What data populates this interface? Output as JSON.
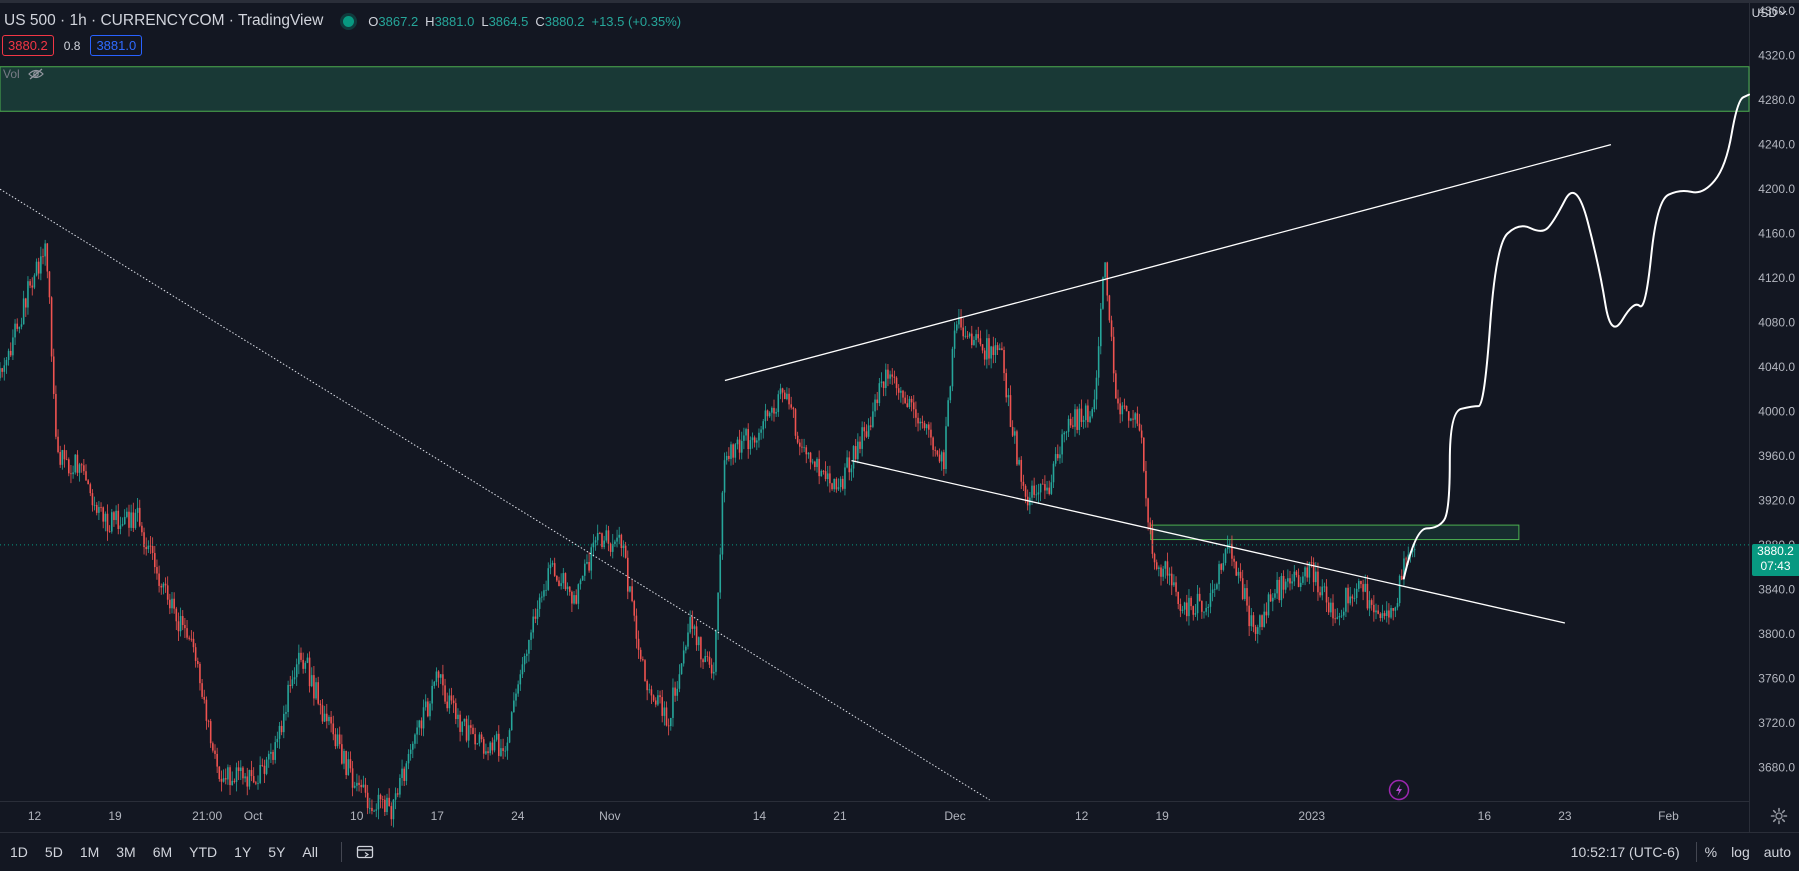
{
  "header": {
    "symbol_title": "US 500 · 1h · CURRENCYCOM · TradingView",
    "ohlc": [
      {
        "key": "O",
        "value": "3867.2"
      },
      {
        "key": "H",
        "value": "3881.0"
      },
      {
        "key": "L",
        "value": "3864.5"
      },
      {
        "key": "C",
        "value": "3880.2"
      }
    ],
    "change": "+13.5 (+0.35%)",
    "bid": "3880.2",
    "spread": "0.8",
    "ask": "3881.0",
    "vol_label": "Vol"
  },
  "price_axis": {
    "currency": "USD",
    "last_price": "3880.2",
    "countdown": "07:43"
  },
  "timeframes": [
    "1D",
    "5D",
    "1M",
    "3M",
    "6M",
    "YTD",
    "1Y",
    "5Y",
    "All"
  ],
  "footer": {
    "clock": "10:52:17 (UTC-6)",
    "percent_label": "%",
    "log_label": "log",
    "auto_label": "auto"
  },
  "colors": {
    "background": "#131722",
    "up": "#26a69a",
    "down": "#ef5350",
    "zone_fill": "#1b3f3a",
    "zone_border": "#4caf50",
    "drawing": "#ffffff",
    "price_tag": "#089981"
  },
  "icons": {
    "live": "live-status-dot",
    "visibility": "eye-off-icon",
    "calendar": "goto-date-icon",
    "settings": "gear-icon",
    "event": "lightning-icon",
    "currency_menu": "chevron-down-icon"
  },
  "chart_data": {
    "type": "candlestick",
    "interval": "1h",
    "y_axis": {
      "ticks": [
        3680,
        3720,
        3760,
        3800,
        3840,
        3880,
        3920,
        3960,
        4000,
        4040,
        4080,
        4120,
        4160,
        4200,
        4240,
        4280,
        4320,
        4360
      ],
      "tick_labels": [
        "3680.0",
        "3720.0",
        "3760.0",
        "3800.0",
        "3840.0",
        "3880.0",
        "3920.0",
        "3960.0",
        "4000.0",
        "4040.0",
        "4080.0",
        "4120.0",
        "4160.0",
        "4200.0",
        "4240.0",
        "4280.0",
        "4320.0",
        "4360.0"
      ],
      "range": [
        3650,
        4370
      ]
    },
    "x_axis": {
      "tick_labels": [
        "12",
        "19",
        "21:00",
        "Oct",
        "10",
        "17",
        "24",
        "Nov",
        "14",
        "21",
        "Dec",
        "12",
        "19",
        "2023",
        "16",
        "23",
        "Feb"
      ],
      "tick_dates": [
        "2022-09-12",
        "2022-09-19",
        "2022-09-27",
        "2022-10-01",
        "2022-10-10",
        "2022-10-17",
        "2022-10-24",
        "2022-11-01",
        "2022-11-14",
        "2022-11-21",
        "2022-12-01",
        "2022-12-12",
        "2022-12-19",
        "2023-01-01",
        "2023-01-16",
        "2023-01-23",
        "2023-02-01"
      ],
      "range": [
        "2022-09-09",
        "2023-02-08"
      ]
    },
    "price_path": [
      [
        "2022-09-09",
        4030
      ],
      [
        "2022-09-12",
        4125
      ],
      [
        "2022-09-13",
        4150
      ],
      [
        "2022-09-14",
        3960
      ],
      [
        "2022-09-16",
        3950
      ],
      [
        "2022-09-18",
        3900
      ],
      [
        "2022-09-21",
        3905
      ],
      [
        "2022-09-22",
        3870
      ],
      [
        "2022-09-26",
        3780
      ],
      [
        "2022-09-28",
        3670
      ],
      [
        "2022-09-30",
        3680
      ],
      [
        "2022-10-01",
        3665
      ],
      [
        "2022-10-03",
        3700
      ],
      [
        "2022-10-05",
        3790
      ],
      [
        "2022-10-07",
        3730
      ],
      [
        "2022-10-10",
        3660
      ],
      [
        "2022-10-13",
        3640
      ],
      [
        "2022-10-15",
        3700
      ],
      [
        "2022-10-17",
        3760
      ],
      [
        "2022-10-19",
        3720
      ],
      [
        "2022-10-21",
        3700
      ],
      [
        "2022-10-23",
        3700
      ],
      [
        "2022-10-25",
        3800
      ],
      [
        "2022-10-27",
        3860
      ],
      [
        "2022-10-29",
        3830
      ],
      [
        "2022-10-31",
        3890
      ],
      [
        "2022-11-02",
        3880
      ],
      [
        "2022-11-04",
        3760
      ],
      [
        "2022-11-06",
        3720
      ],
      [
        "2022-11-08",
        3810
      ],
      [
        "2022-11-10",
        3760
      ],
      [
        "2022-11-11",
        3960
      ],
      [
        "2022-11-14",
        3985
      ],
      [
        "2022-11-16",
        4020
      ],
      [
        "2022-11-18",
        3960
      ],
      [
        "2022-11-21",
        3935
      ],
      [
        "2022-11-23",
        3980
      ],
      [
        "2022-11-25",
        4030
      ],
      [
        "2022-11-28",
        3990
      ],
      [
        "2022-11-30",
        3955
      ],
      [
        "2022-12-01",
        4085
      ],
      [
        "2022-12-03",
        4060
      ],
      [
        "2022-12-05",
        4050
      ],
      [
        "2022-12-07",
        3920
      ],
      [
        "2022-12-09",
        3930
      ],
      [
        "2022-12-11",
        3990
      ],
      [
        "2022-12-13",
        4000
      ],
      [
        "2022-12-14",
        4130
      ],
      [
        "2022-12-15",
        4010
      ],
      [
        "2022-12-17",
        3990
      ],
      [
        "2022-12-18",
        3880
      ],
      [
        "2022-12-21",
        3820
      ],
      [
        "2022-12-23",
        3830
      ],
      [
        "2022-12-25",
        3880
      ],
      [
        "2022-12-27",
        3800
      ],
      [
        "2022-12-29",
        3840
      ],
      [
        "2023-01-01",
        3855
      ],
      [
        "2023-01-03",
        3820
      ],
      [
        "2023-01-05",
        3845
      ],
      [
        "2023-01-06",
        3830
      ],
      [
        "2023-01-08",
        3815
      ],
      [
        "2023-01-09",
        3860
      ],
      [
        "2023-01-10",
        3880
      ]
    ],
    "zones": [
      {
        "from": 4270,
        "to": 4310
      },
      {
        "from": 3885,
        "to": 3898,
        "start": "2022-12-18",
        "end": "2023-01-19"
      }
    ],
    "trendlines": [
      {
        "style": "solid",
        "points": [
          [
            "2022-11-11",
            4028
          ],
          [
            "2023-01-27",
            4240
          ]
        ]
      },
      {
        "style": "solid",
        "points": [
          [
            "2022-11-22",
            3956
          ],
          [
            "2023-01-23",
            3810
          ]
        ]
      },
      {
        "style": "dotted",
        "points": [
          [
            "2022-09-09",
            4200
          ],
          [
            "2022-12-04",
            3651
          ]
        ]
      }
    ],
    "projection": [
      [
        "2023-01-09",
        3850
      ],
      [
        "2023-01-10",
        3895
      ],
      [
        "2023-01-12",
        3895
      ],
      [
        "2023-01-13",
        3910
      ],
      [
        "2023-01-13",
        4000
      ],
      [
        "2023-01-15",
        4005
      ],
      [
        "2023-01-16",
        4005
      ],
      [
        "2023-01-17",
        4150
      ],
      [
        "2023-01-19",
        4170
      ],
      [
        "2023-01-21",
        4160
      ],
      [
        "2023-01-22",
        4170
      ],
      [
        "2023-01-24",
        4210
      ],
      [
        "2023-01-26",
        4130
      ],
      [
        "2023-01-27",
        4065
      ],
      [
        "2023-01-29",
        4100
      ],
      [
        "2023-01-30",
        4090
      ],
      [
        "2023-01-31",
        4190
      ],
      [
        "2023-02-02",
        4200
      ],
      [
        "2023-02-04",
        4195
      ],
      [
        "2023-02-06",
        4220
      ],
      [
        "2023-02-07",
        4280
      ],
      [
        "2023-02-08",
        4285
      ]
    ],
    "last_price": 3880.2
  }
}
